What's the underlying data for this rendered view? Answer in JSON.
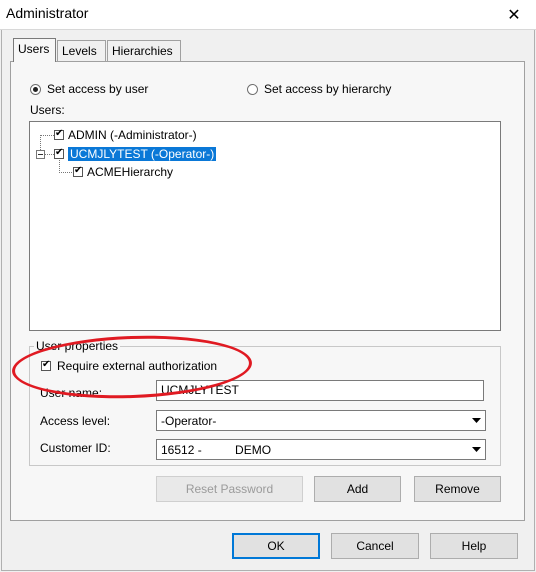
{
  "window": {
    "title": "Administrator",
    "close_glyph": "✕"
  },
  "tabs": [
    {
      "label": "Users",
      "active": true
    },
    {
      "label": "Levels",
      "active": false
    },
    {
      "label": "Hierarchies",
      "active": false
    }
  ],
  "access_mode": {
    "by_user_label": "Set access by user",
    "by_hierarchy_label": "Set access by hierarchy",
    "selected": "by_user"
  },
  "users_label": "Users:",
  "tree": [
    {
      "label": "ADMIN (-Administrator-)",
      "checked": true,
      "selected": false,
      "level": 0
    },
    {
      "label": "UCMJLYTEST (-Operator-)",
      "checked": true,
      "selected": true,
      "level": 0,
      "expanded": true
    },
    {
      "label": "ACMEHierarchy",
      "checked": true,
      "selected": false,
      "level": 1
    }
  ],
  "user_properties": {
    "group_label": "User properties",
    "require_ext_auth_label": "Require external authorization",
    "require_ext_auth_checked": true,
    "user_name_label": "User name:",
    "user_name_value": "UCMJLYTEST",
    "access_level_label": "Access level:",
    "access_level_value": "-Operator-",
    "customer_id_label": "Customer ID:",
    "customer_id_value": "16512 -          DEMO"
  },
  "buttons": {
    "reset_password": "Reset Password",
    "add": "Add",
    "remove": "Remove",
    "ok": "OK",
    "cancel": "Cancel",
    "help": "Help"
  },
  "icons": {
    "close": "close-icon",
    "dropdown": "chevron-down-icon",
    "check": "checkbox-checked-icon"
  },
  "colors": {
    "selection": "#0a78d7",
    "annotation": "#e01a22",
    "dialog_bg": "#f0f0f0"
  }
}
